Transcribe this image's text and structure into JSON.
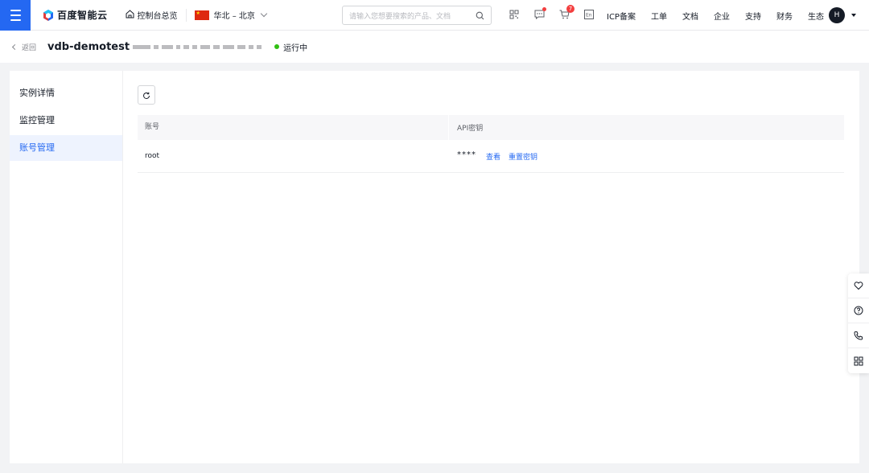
{
  "brand": {
    "name": "百度智能云"
  },
  "topnav": {
    "home_label": "控制台总览",
    "region_label": "华北 – 北京",
    "search_placeholder": "请输入您想要搜索的产品、文档",
    "cart_count": "7",
    "links": [
      "ICP备案",
      "工单",
      "文档",
      "企业",
      "支持",
      "财务",
      "生态"
    ],
    "avatar_initial": "H"
  },
  "subhead": {
    "back_label": "返回",
    "instance_name": "vdb-demotest",
    "status_label": "运行中",
    "status_color": "#30bf13"
  },
  "sidebar": {
    "items": [
      {
        "label": "实例详情",
        "active": false
      },
      {
        "label": "监控管理",
        "active": false
      },
      {
        "label": "账号管理",
        "active": true
      }
    ]
  },
  "table": {
    "columns": [
      "账号",
      "API密钥"
    ],
    "rows": [
      {
        "account": "root",
        "api_key_masked": "****",
        "view_label": "查看",
        "reset_label": "重置密钥"
      }
    ]
  },
  "colors": {
    "accent": "#2468f2",
    "badge": "#f33e3e"
  }
}
